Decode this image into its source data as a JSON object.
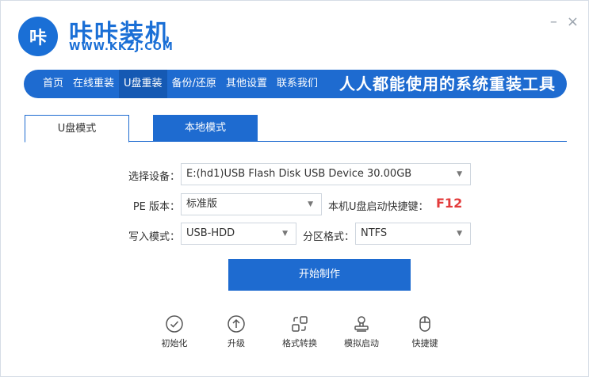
{
  "header": {
    "logo_text": "咔",
    "title": "咔咔装机",
    "url": "WWW.KKZJ.COM",
    "minimize": "–",
    "close": "×"
  },
  "nav": {
    "items": [
      {
        "label": "首页"
      },
      {
        "label": "在线重装"
      },
      {
        "label": "U盘重装"
      },
      {
        "label": "备份/还原"
      },
      {
        "label": "其他设置"
      },
      {
        "label": "联系我们"
      }
    ],
    "active_index": 2,
    "slogan": "人人都能使用的系统重装工具"
  },
  "tabs": {
    "usb_mode": "U盘模式",
    "local_mode": "本地模式"
  },
  "form": {
    "device_label": "选择设备：",
    "device_value": "E:(hd1)USB Flash Disk USB Device 30.00GB",
    "pe_label": "PE 版本：",
    "pe_value": "标准版",
    "hotkey_label": "本机U盘启动快捷键：",
    "hotkey_value": "F12",
    "write_label": "写入模式：",
    "write_value": "USB-HDD",
    "format_label": "分区格式：",
    "format_value": "NTFS",
    "start_button": "开始制作"
  },
  "tools": [
    {
      "label": "初始化",
      "icon": "check-circle-icon"
    },
    {
      "label": "升级",
      "icon": "arrow-up-circle-icon"
    },
    {
      "label": "格式转换",
      "icon": "convert-icon"
    },
    {
      "label": "模拟启动",
      "icon": "stamp-icon"
    },
    {
      "label": "快捷键",
      "icon": "mouse-icon"
    }
  ],
  "colors": {
    "brand_blue": "#1e6bd0",
    "hotkey_red": "#e33b3b"
  }
}
